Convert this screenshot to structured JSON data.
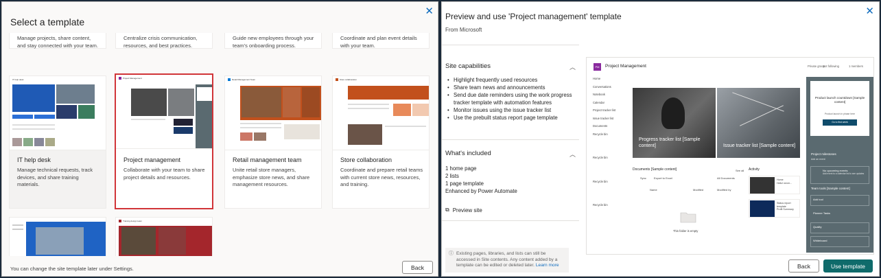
{
  "left": {
    "title": "Select a template",
    "close_icon": "close-icon",
    "cards_row1": [
      {
        "desc": "Manage projects, share content, and stay connected with your team."
      },
      {
        "desc": "Centralize crisis communication, resources, and best practices."
      },
      {
        "desc": "Guide new employees through your team's onboarding process."
      },
      {
        "desc": "Coordinate and plan event details with your team."
      }
    ],
    "cards_row2": [
      {
        "title": "IT help desk",
        "desc": "Manage technical requests, track devices, and share training materials."
      },
      {
        "title": "Project management",
        "desc": "Collaborate with your team to share project details and resources.",
        "selected": true
      },
      {
        "title": "Retail management team",
        "desc": "Unite retail store managers, emphasize store news, and share management resources."
      },
      {
        "title": "Store collaboration",
        "desc": "Coordinate and prepare retail teams with current store news, resources, and training."
      }
    ],
    "thumb_labels": {
      "it": "IT help desk",
      "pm": "Project Management",
      "retail": "Retail Management Team",
      "store": "Store collaboration",
      "r3b": "Training design team"
    },
    "footnote": "You can change the site template later under Settings.",
    "back_label": "Back"
  },
  "right": {
    "title": "Preview and use 'Project management' template",
    "from": "From Microsoft",
    "capabilities_heading": "Site capabilities",
    "capabilities": [
      "Highlight frequently used resources",
      "Share team news and announcements",
      "Send due date reminders using the work progress tracker template with automation features",
      "Monitor issues using the issue tracker list",
      "Use the prebuilt status report page template"
    ],
    "included_heading": "What's included",
    "included": [
      "1 home page",
      "2 lists",
      "1 page template",
      "Enhanced by Power Automate"
    ],
    "preview_site": "Preview site",
    "notice": "Existing pages, libraries, and lists can still be accessed in Site contents. Any content added by a template can be edited or deleted later.",
    "learn_more": "Learn more",
    "back_label": "Back",
    "use_label": "Use template",
    "preview": {
      "logo": "PM",
      "site_title": "Project Management",
      "top_links": [
        "Private group",
        "Not following",
        "1 members"
      ],
      "nav": [
        "Home",
        "Conversations",
        "Notebook",
        "Calendar",
        "Project tracker list",
        "Issue tracker list",
        "Documents",
        "Recycle bin",
        "",
        "",
        "Recycle bin",
        "",
        "",
        "Recycle bin",
        "",
        "",
        "Recycle bin"
      ],
      "hero1": "Progress tracker list [Sample content]",
      "hero2": "Issue tracker list [Sample content]",
      "docs_heading": "Documents [Sample content]",
      "see_all": "See all",
      "docs_toolbar": [
        "Sync",
        "Export to Excel",
        "All Documents"
      ],
      "col_name": "Name",
      "col_modified": "Modified",
      "col_modified_by": "Modified by",
      "empty": "This folder is empty",
      "activity_heading": "Activity",
      "act1": "Home",
      "act1_sub": "Hello! never...",
      "act2": "Status report template",
      "act2_sub": "Profit Summary",
      "countdown_title": "Product launch countdown [Sample content]",
      "countdown_sub": "Product launch in phase here",
      "countdown_btn": "Go to first week",
      "milestones": "Project milestones",
      "milestones_sub": "Add an event",
      "no_events": "No upcoming events",
      "no_events_sub": "Add event to a calendar list to see updates",
      "tools": "Team tools [Sample content]",
      "tool_items": [
        "Add tool",
        "Planner Tasks",
        "Quality",
        "Whiteboard"
      ]
    }
  }
}
